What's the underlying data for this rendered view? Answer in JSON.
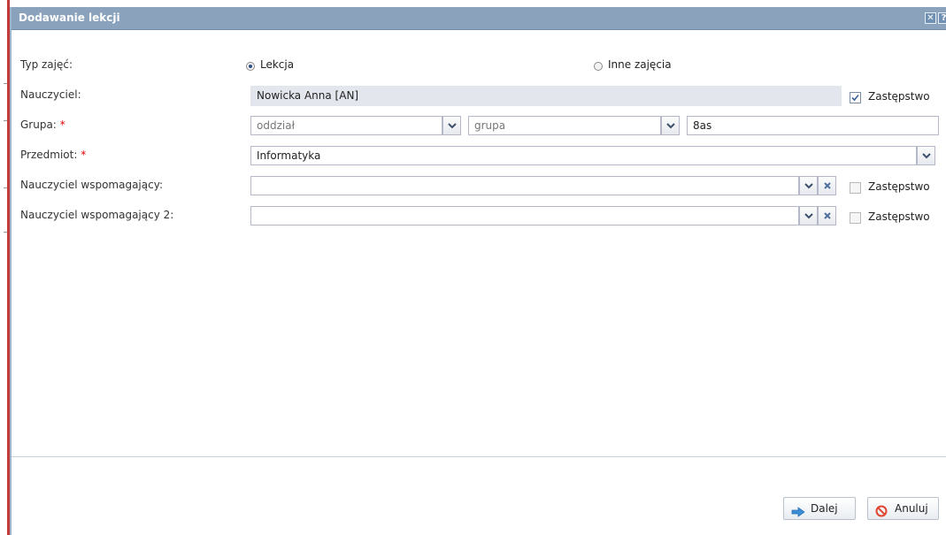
{
  "dialog": {
    "title": "Dodawanie lekcji"
  },
  "form": {
    "type": {
      "label": "Typ zajęć:",
      "options": [
        "Lekcja",
        "Inne zajęcia"
      ],
      "selected": "Lekcja"
    },
    "teacher": {
      "label": "Nauczyciel:",
      "value": "Nowicka Anna [AN]",
      "substitute_label": "Zastępstwo",
      "substitute_checked": true
    },
    "group": {
      "label": "Grupa:",
      "required_mark": "*",
      "division_placeholder": "oddział",
      "group_placeholder": "grupa",
      "value": "8as"
    },
    "subject": {
      "label": "Przedmiot:",
      "required_mark": "*",
      "value": "Informatyka"
    },
    "support_teacher": {
      "label": "Nauczyciel wspomagający:",
      "value": "",
      "substitute_label": "Zastępstwo",
      "substitute_checked": false
    },
    "support_teacher_2": {
      "label": "Nauczyciel wspomagający 2:",
      "value": "",
      "substitute_label": "Zastępstwo",
      "substitute_checked": false
    }
  },
  "buttons": {
    "next": "Dalej",
    "cancel": "Anuluj"
  }
}
